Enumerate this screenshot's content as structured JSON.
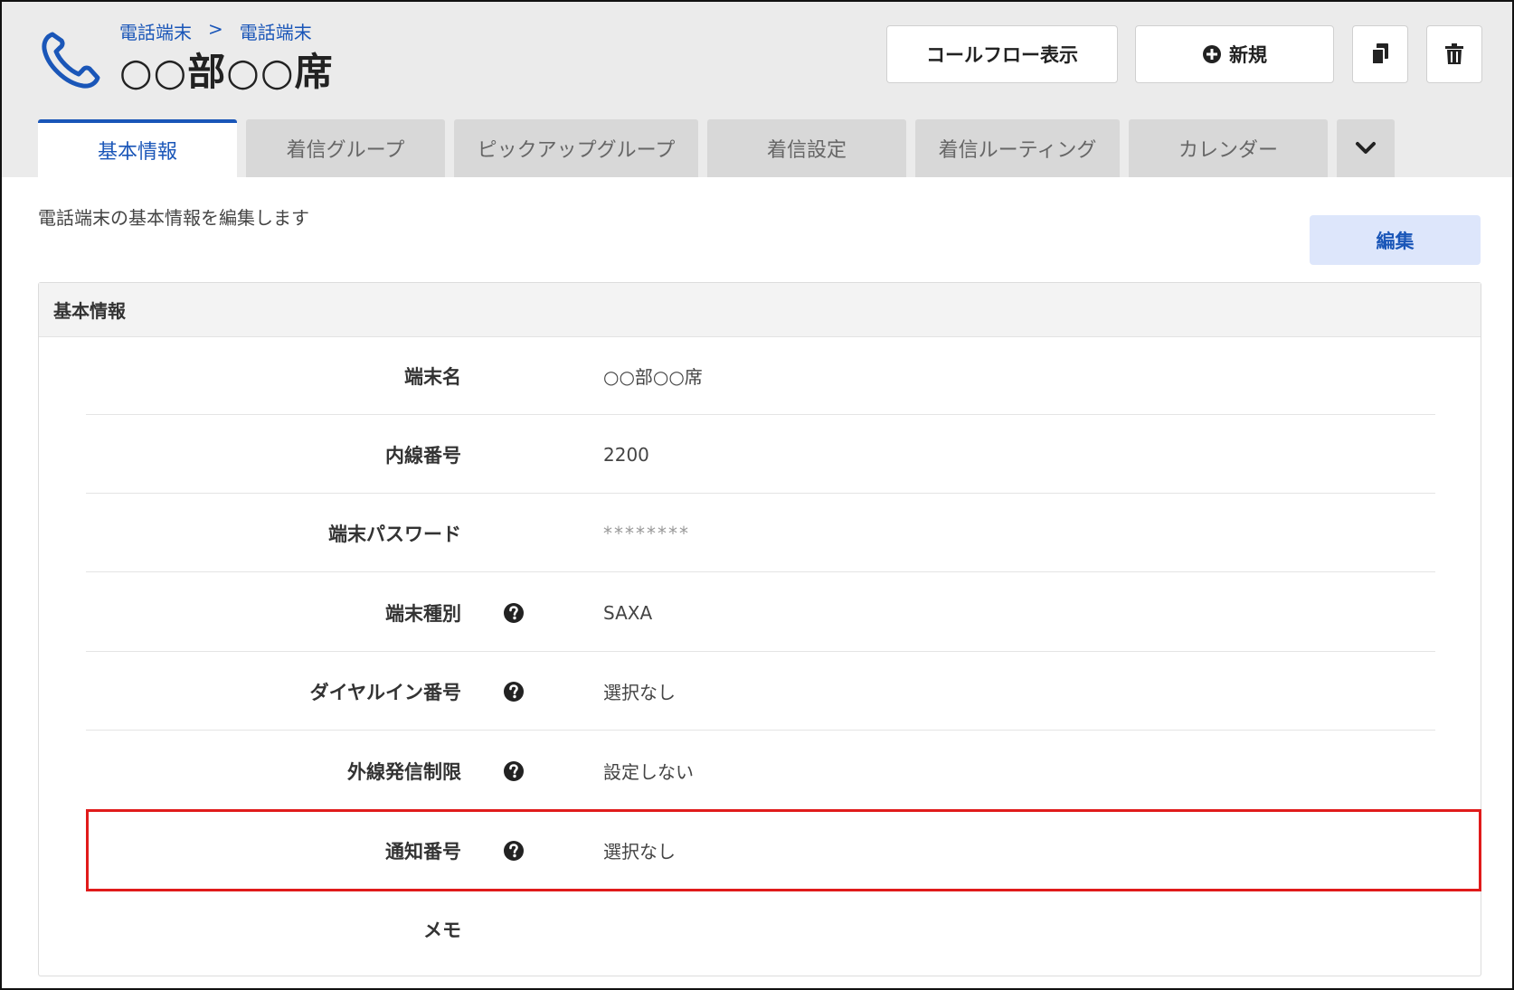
{
  "header": {
    "breadcrumb": [
      "電話端末",
      ">",
      "電話端末"
    ],
    "title": "○○部○○席",
    "buttons": {
      "call_flow": "コールフロー表示",
      "new": "新規"
    }
  },
  "tabs": [
    {
      "label": "基本情報",
      "active": true
    },
    {
      "label": "着信グループ",
      "active": false
    },
    {
      "label": "ピックアップグループ",
      "active": false
    },
    {
      "label": "着信設定",
      "active": false
    },
    {
      "label": "着信ルーティング",
      "active": false
    },
    {
      "label": "カレンダー",
      "active": false
    }
  ],
  "content": {
    "description": "電話端末の基本情報を編集します",
    "edit_label": "編集"
  },
  "panel": {
    "title": "基本情報",
    "rows": [
      {
        "label": "端末名",
        "value": "○○部○○席",
        "help": false
      },
      {
        "label": "内線番号",
        "value": "2200",
        "help": false
      },
      {
        "label": "端末パスワード",
        "value": "********",
        "help": false
      },
      {
        "label": "端末種別",
        "value": "SAXA",
        "help": true
      },
      {
        "label": "ダイヤルイン番号",
        "value": "選択なし",
        "help": true
      },
      {
        "label": "外線発信制限",
        "value": "設定しない",
        "help": true
      },
      {
        "label": "通知番号",
        "value": "選択なし",
        "help": true
      },
      {
        "label": "メモ",
        "value": "",
        "help": false
      }
    ]
  },
  "colors": {
    "accent": "#1a56b8",
    "highlight": "#e01b1b",
    "header_bg": "#ebebeb",
    "tab_bg": "#d8d8d8",
    "edit_bg": "#dde6fb"
  },
  "icons": {
    "title": "phone-icon",
    "new": "plus-circle-icon",
    "copy": "copy-icon",
    "delete": "trash-icon",
    "more_tabs": "chevron-down-icon",
    "help": "question-circle-icon"
  }
}
